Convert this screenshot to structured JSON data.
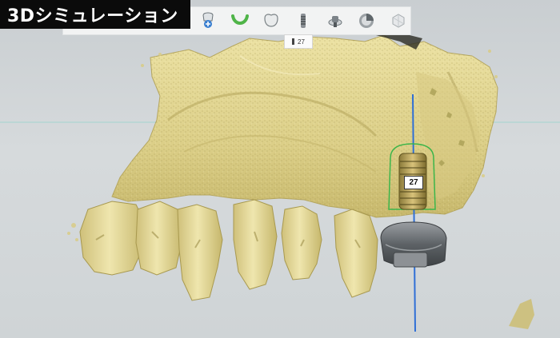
{
  "title": "3Dシミュレーション",
  "toolbar": {
    "icons": [
      "implant-plan-icon",
      "arch-icon",
      "crown-icon",
      "implant-icon",
      "abutment-icon",
      "bone-density-icon",
      "model-icon"
    ]
  },
  "tooth_label": "27",
  "implant_number": "27",
  "colors": {
    "bone": "#e2d592",
    "bone_shadow": "#b9ab62",
    "implant_outline": "#3bb54a",
    "axis_line": "#2f6fd6",
    "title_background": "#0b0b0b"
  }
}
